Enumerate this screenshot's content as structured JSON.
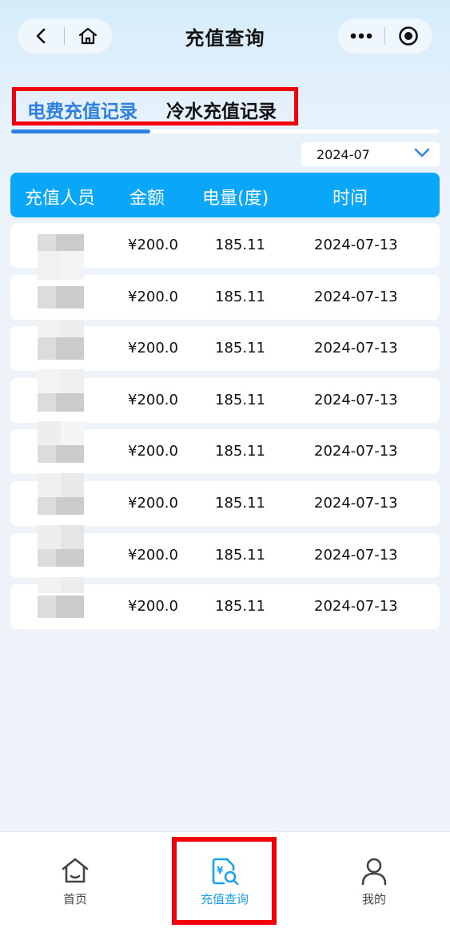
{
  "header": {
    "title": "充值查询",
    "back_icon": "chevron-left-icon",
    "home_icon": "home-icon",
    "more_icon": "more-dots-icon",
    "close_icon": "record-circle-icon"
  },
  "tabs": [
    {
      "label": "电费充值记录",
      "active": true
    },
    {
      "label": "冷水充值记录",
      "active": false
    }
  ],
  "date_filter": {
    "value": "2024-07"
  },
  "table": {
    "headers": [
      "充值人员",
      "金额",
      "电量(度)",
      "时间"
    ],
    "rows": [
      {
        "amount": "¥200.0",
        "kwh": "185.11",
        "date": "2024-07-13"
      },
      {
        "amount": "¥200.0",
        "kwh": "185.11",
        "date": "2024-07-13"
      },
      {
        "amount": "¥200.0",
        "kwh": "185.11",
        "date": "2024-07-13"
      },
      {
        "amount": "¥200.0",
        "kwh": "185.11",
        "date": "2024-07-13"
      },
      {
        "amount": "¥200.0",
        "kwh": "185.11",
        "date": "2024-07-13"
      },
      {
        "amount": "¥200.0",
        "kwh": "185.11",
        "date": "2024-07-13"
      },
      {
        "amount": "¥200.0",
        "kwh": "185.11",
        "date": "2024-07-13"
      },
      {
        "amount": "¥200.0",
        "kwh": "185.11",
        "date": "2024-07-13"
      }
    ]
  },
  "tabbar": {
    "items": [
      {
        "label": "首页",
        "icon": "home-icon"
      },
      {
        "label": "充值查询",
        "icon": "recharge-search-icon",
        "active": true
      },
      {
        "label": "我的",
        "icon": "user-icon"
      }
    ]
  },
  "colors": {
    "accent": "#2f7fe0",
    "table_header": "#0aa7f8",
    "highlight": "#f2000c",
    "tab_active": "#1aa1f0"
  }
}
